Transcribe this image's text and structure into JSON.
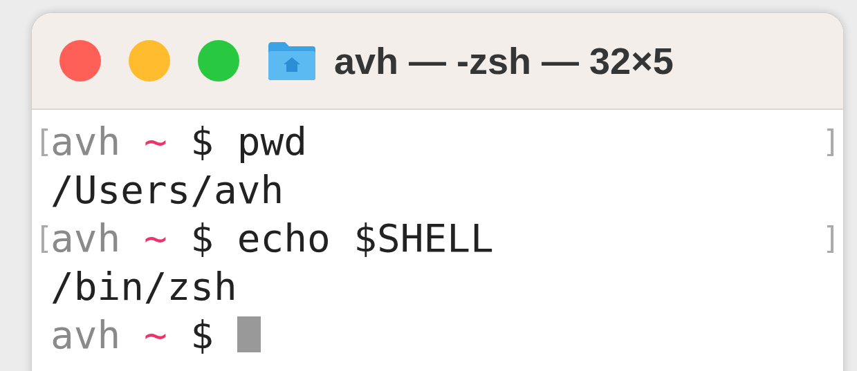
{
  "window": {
    "title": "avh — -zsh — 32×5"
  },
  "lines": [
    {
      "kind": "prompt",
      "open": "[",
      "user": "avh",
      "dir": "~",
      "symbol": "$",
      "command": "pwd",
      "close": "]",
      "cursor": false
    },
    {
      "kind": "output",
      "text": "/Users/avh"
    },
    {
      "kind": "prompt",
      "open": "[",
      "user": "avh",
      "dir": "~",
      "symbol": "$",
      "command": "echo $SHELL",
      "close": "]",
      "cursor": false
    },
    {
      "kind": "output",
      "text": "/bin/zsh"
    },
    {
      "kind": "prompt",
      "user": "avh",
      "dir": "~",
      "symbol": "$",
      "cursor": true
    }
  ]
}
